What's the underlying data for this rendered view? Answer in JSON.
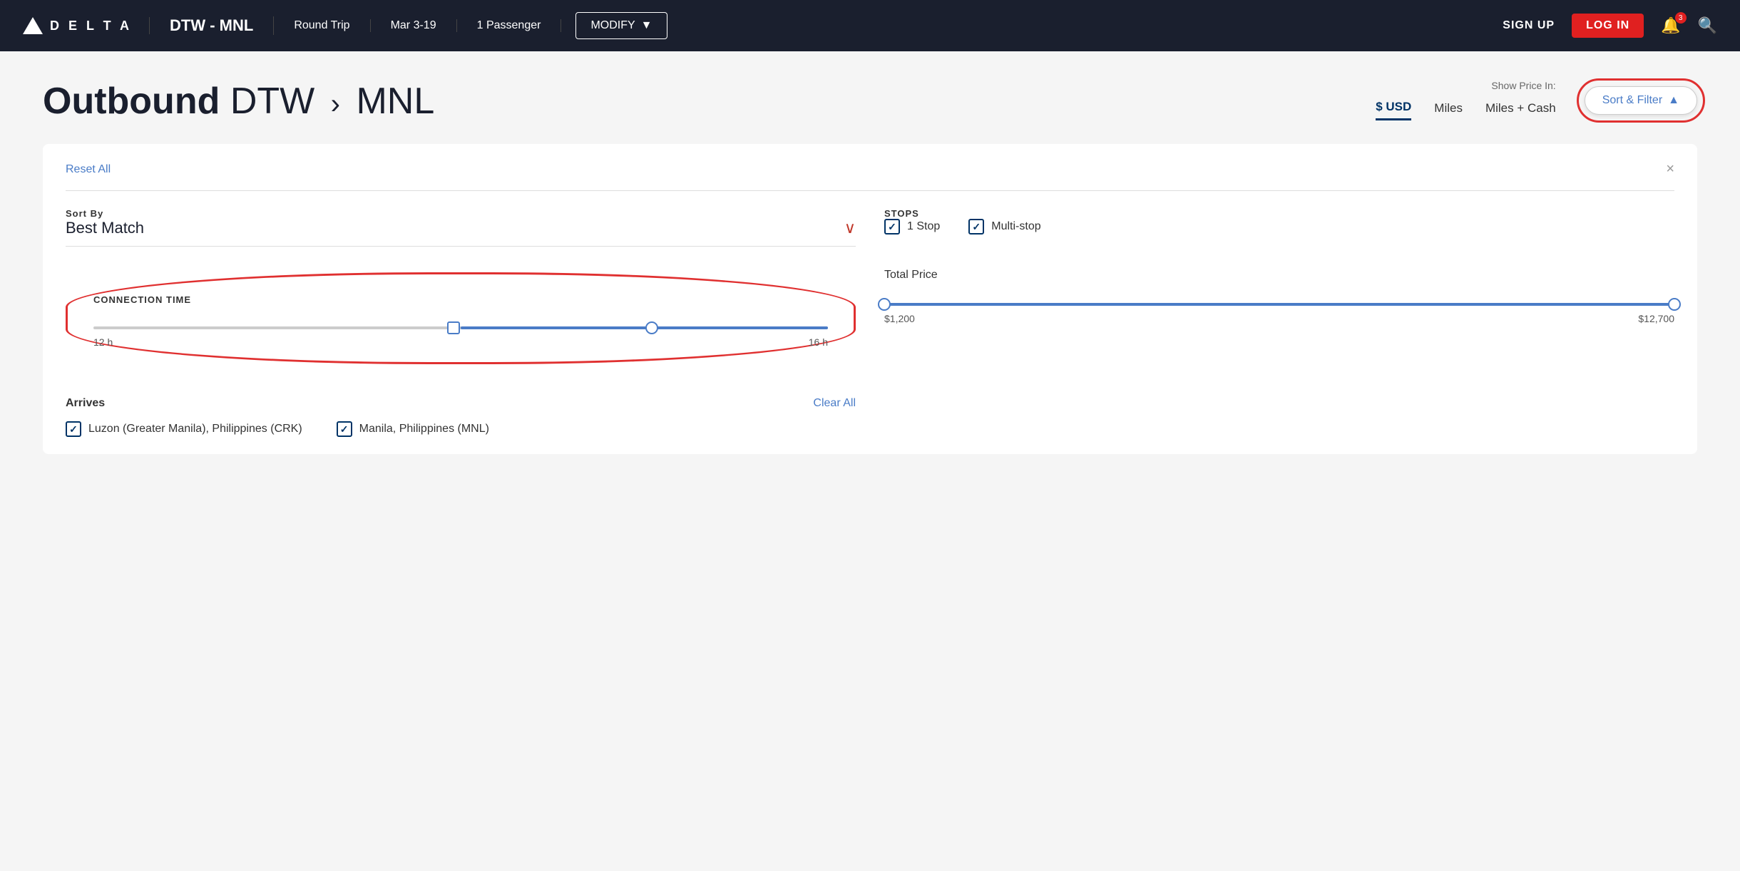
{
  "header": {
    "logo_text": "D E L T A",
    "route": "DTW - MNL",
    "trip_type": "Round Trip",
    "dates": "Mar 3-19",
    "passengers": "1 Passenger",
    "modify_label": "MODIFY",
    "signup_label": "SIGN UP",
    "login_label": "LOG IN",
    "notification_count": "3"
  },
  "page": {
    "title_bold": "Outbound",
    "title_origin": "DTW",
    "title_arrow": "›",
    "title_dest": "MNL",
    "show_price_label": "Show Price In:",
    "price_usd": "$ USD",
    "price_miles": "Miles",
    "price_miles_cash": "Miles + Cash",
    "sort_filter_label": "Sort & Filter",
    "sort_filter_icon": "▲"
  },
  "filters": {
    "reset_label": "Reset All",
    "close_icon": "×",
    "sort_by_label": "Sort By",
    "sort_value": "Best Match",
    "connection_time_label": "CONNECTION TIME",
    "connection_min": "12 h",
    "connection_max": "16 h",
    "stops_label": "STOPS",
    "stop1_label": "1 Stop",
    "stop1_checked": true,
    "stop2_label": "Multi-stop",
    "stop2_checked": true,
    "total_price_label": "Total Price",
    "price_min": "$1,200",
    "price_max": "$12,700",
    "arrives_label": "Arrives",
    "clear_all_label": "Clear All",
    "arrives_item1": "Luzon (Greater Manila), Philippines (CRK)",
    "arrives_item2": "Manila, Philippines (MNL)",
    "arrives_item1_checked": true,
    "arrives_item2_checked": true
  }
}
